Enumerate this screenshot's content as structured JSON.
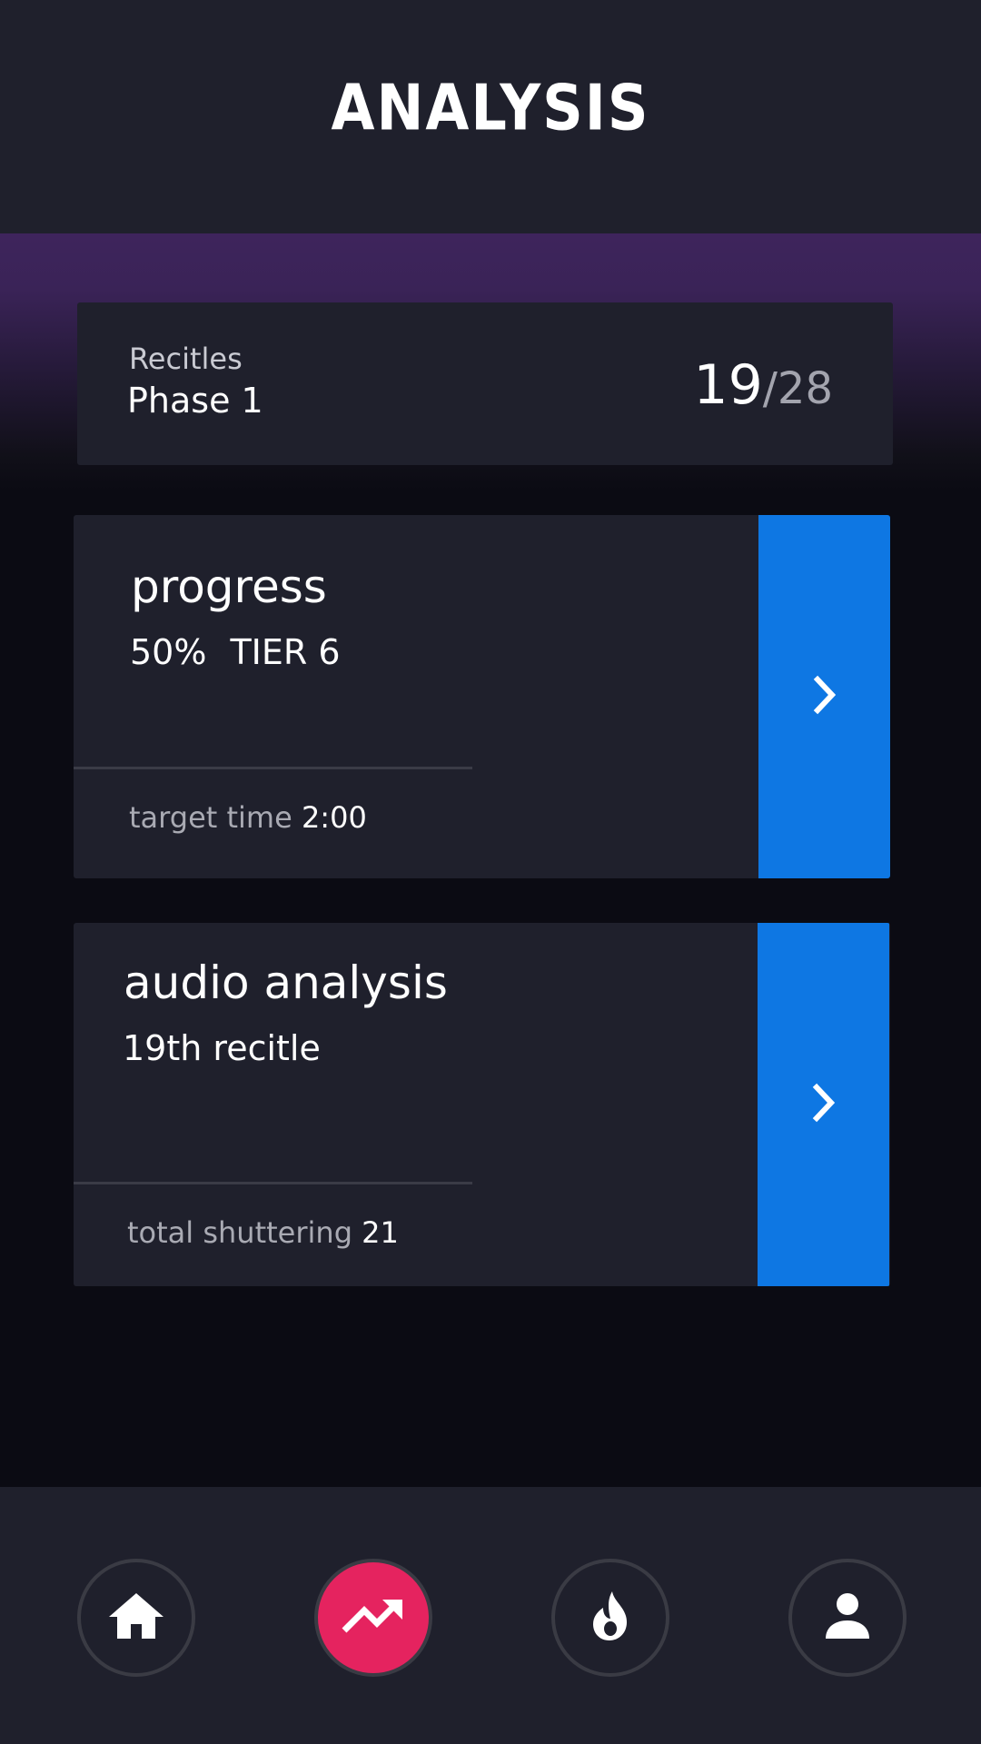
{
  "header": {
    "title": "ANALYSIS"
  },
  "summary": {
    "label": "Recitles",
    "value": "Phase 1",
    "count_current": "19",
    "count_total_text": "/28"
  },
  "cards": [
    {
      "title": "progress",
      "subtitle_percent": "50%",
      "subtitle_tier": "TIER 6",
      "footer_label": "target time",
      "footer_value": "2:00"
    },
    {
      "title": "audio analysis",
      "subtitle": "19th recitle",
      "footer_label": "total shuttering",
      "footer_value": "21"
    }
  ],
  "nav": {
    "items": [
      {
        "icon": "home-icon"
      },
      {
        "icon": "trending-up-icon",
        "active": true
      },
      {
        "icon": "flame-icon"
      },
      {
        "icon": "person-icon"
      }
    ]
  },
  "colors": {
    "accent_blue": "#0e77e3",
    "accent_pink": "#e5235f",
    "card_bg": "#1f202c",
    "page_bg": "#0b0b13"
  }
}
